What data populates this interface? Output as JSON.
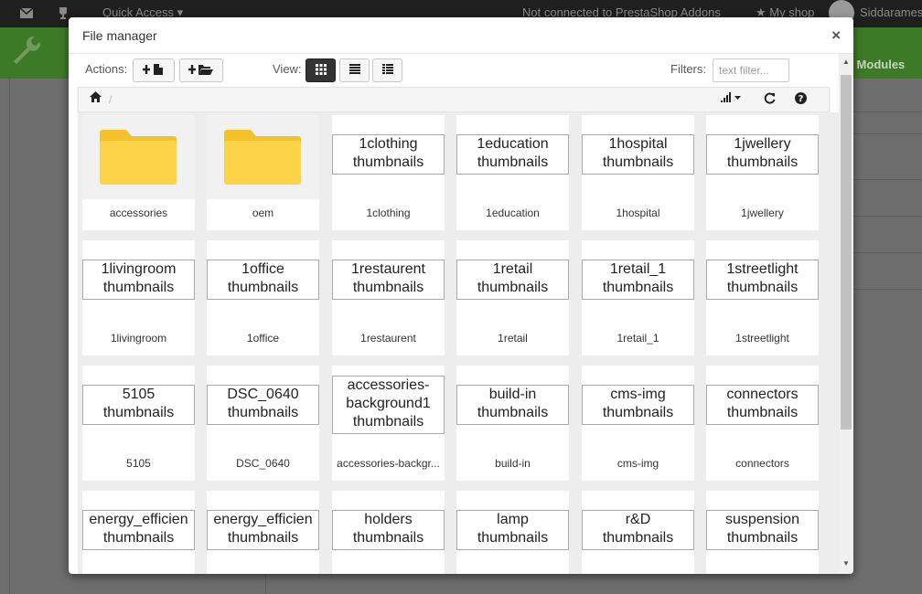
{
  "topbar": {
    "quick_access": "Quick Access",
    "addons_status": "Not connected to PrestaShop Addons",
    "my_shop": "My shop",
    "user": "Siddaramesh"
  },
  "greenbar": {
    "modules_label": "d Modules"
  },
  "modal": {
    "title": "File manager",
    "close": "×",
    "actions_label": "Actions:",
    "view_label": "View:",
    "filters_label": "Filters:",
    "filter_placeholder": "text filter...",
    "breadcrumb_sep": "/"
  },
  "icons": {
    "close": "close-icon",
    "new_file": "add-file-icon",
    "new_folder": "add-folder-icon",
    "view_grid": "grid-view-icon",
    "view_list": "list-view-icon",
    "view_columns": "columns-view-icon",
    "home": "home-icon",
    "sort": "sort-icon",
    "refresh": "refresh-icon",
    "help": "help-icon"
  },
  "active_view": "grid",
  "colors": {
    "folder": "#fdd447",
    "folder_back": "#f3c22a",
    "modules_bar": "#3c7a27"
  },
  "items": [
    {
      "name": "accessories",
      "type": "folder"
    },
    {
      "name": "oem",
      "type": "folder"
    },
    {
      "name": "1clothing",
      "type": "image",
      "alt": "1clothing\nthumbnails"
    },
    {
      "name": "1education",
      "type": "image",
      "alt": "1education\nthumbnails"
    },
    {
      "name": "1hospital",
      "type": "image",
      "alt": "1hospital\nthumbnails"
    },
    {
      "name": "1jwellery",
      "type": "image",
      "alt": "1jwellery\nthumbnails"
    },
    {
      "name": "1livingroom",
      "type": "image",
      "alt": "1livingroom\nthumbnails"
    },
    {
      "name": "1office",
      "type": "image",
      "alt": "1office\nthumbnails"
    },
    {
      "name": "1restaurent",
      "type": "image",
      "alt": "1restaurent\nthumbnails"
    },
    {
      "name": "1retail",
      "type": "image",
      "alt": "1retail\nthumbnails"
    },
    {
      "name": "1retail_1",
      "type": "image",
      "alt": "1retail_1\nthumbnails"
    },
    {
      "name": "1streetlight",
      "type": "image",
      "alt": "1streetlight\nthumbnails"
    },
    {
      "name": "5105",
      "type": "image",
      "alt": "5105\nthumbnails"
    },
    {
      "name": "DSC_0640",
      "type": "image",
      "alt": "DSC_0640\nthumbnails"
    },
    {
      "name": "accessories-backgr...",
      "type": "image",
      "alt": "accessories-\nbackground1\nthumbnails",
      "tall": true
    },
    {
      "name": "build-in",
      "type": "image",
      "alt": "build-in\nthumbnails"
    },
    {
      "name": "cms-img",
      "type": "image",
      "alt": "cms-img\nthumbnails"
    },
    {
      "name": "connectors",
      "type": "image",
      "alt": "connectors\nthumbnails"
    },
    {
      "name": "",
      "type": "image",
      "alt": "energy_efficien\nthumbnails"
    },
    {
      "name": "",
      "type": "image",
      "alt": "energy_efficien\nthumbnails"
    },
    {
      "name": "",
      "type": "image",
      "alt": "holders\nthumbnails"
    },
    {
      "name": "",
      "type": "image",
      "alt": "lamp\nthumbnails"
    },
    {
      "name": "",
      "type": "image",
      "alt": "r&D\nthumbnails"
    },
    {
      "name": "",
      "type": "image",
      "alt": "suspension\nthumbnails"
    }
  ]
}
